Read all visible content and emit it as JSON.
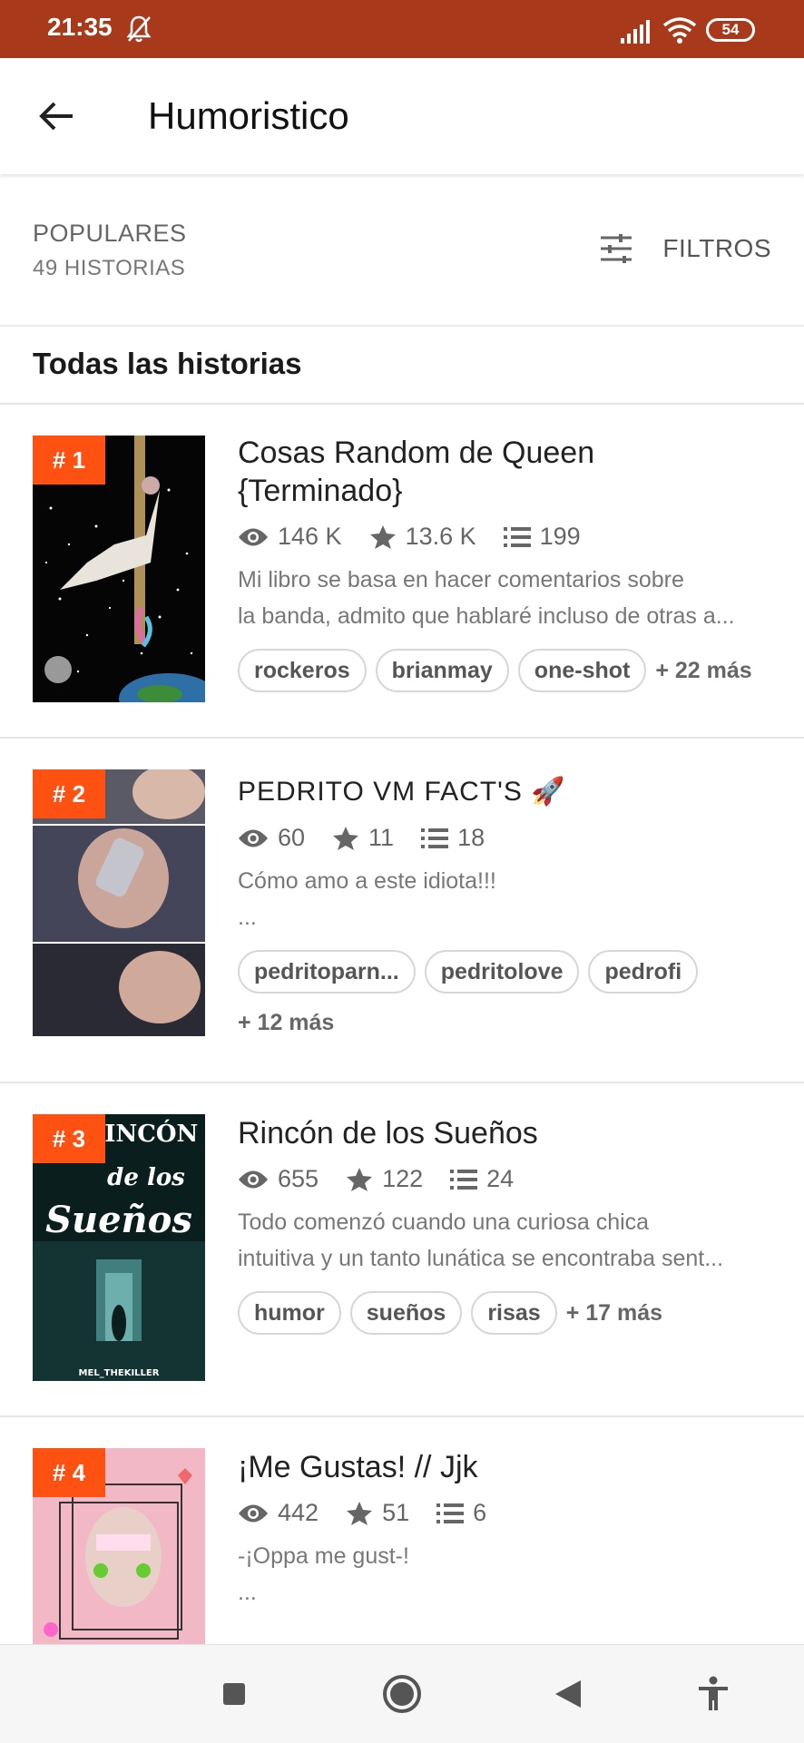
{
  "status_bar": {
    "time": "21:35",
    "battery": "54"
  },
  "app_bar": {
    "title": "Humoristico"
  },
  "sort": {
    "label": "POPULARES",
    "count": "49 HISTORIAS",
    "filters_label": "FILTROS"
  },
  "section": {
    "title": "Todas las historias"
  },
  "stories": [
    {
      "rank": "# 1",
      "title_line1": "Cosas Random de Queen",
      "title_line2": "{Terminado}",
      "views": "146 K",
      "votes": "13.6 K",
      "parts": "199",
      "desc_line1": "Mi libro se basa en hacer comentarios sobre",
      "desc_line2": "la banda, admito que hablaré incluso de otras a...",
      "tags": [
        "rockeros",
        "brianmay",
        "one-shot"
      ],
      "more": "+ 22 más"
    },
    {
      "rank": "# 2",
      "title_line1": "PEDRITO VM FACT'S 🚀",
      "title_line2": "",
      "views": "60",
      "votes": "11",
      "parts": "18",
      "desc_line1": "Cómo amo a este idiota!!!",
      "desc_line2": "...",
      "tags": [
        "pedritoparn...",
        "pedritolove",
        "pedrofi"
      ],
      "more": "+ 12 más"
    },
    {
      "rank": "# 3",
      "title_line1": "Rincón de los Sueños",
      "title_line2": "",
      "views": "655",
      "votes": "122",
      "parts": "24",
      "desc_line1": "Todo comenzó cuando una curiosa chica",
      "desc_line2": "intuitiva y un tanto lunática se encontraba sent...",
      "tags": [
        "humor",
        "sueños",
        "risas"
      ],
      "more": "+ 17 más",
      "cover_text1": "RINCÓN",
      "cover_text2": "de los",
      "cover_text3": "Sueños",
      "cover_author": "MEL_THEKILLER"
    },
    {
      "rank": "# 4",
      "title_line1": "¡Me Gustas! // Jjk",
      "title_line2": "",
      "views": "442",
      "votes": "51",
      "parts": "6",
      "desc_line1": "-¡Oppa me gust-!",
      "desc_line2": "..."
    }
  ]
}
